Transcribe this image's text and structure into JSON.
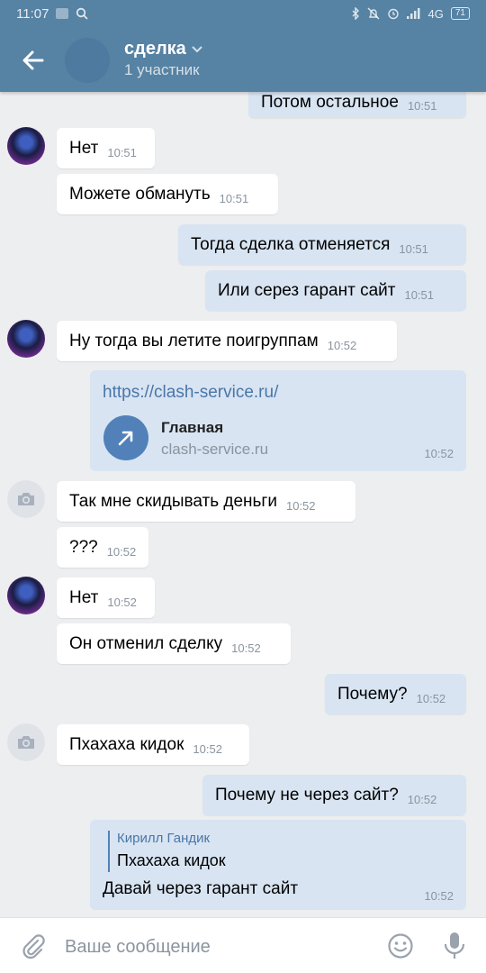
{
  "status": {
    "time": "11:07",
    "battery": "71",
    "network": "4G"
  },
  "header": {
    "title": "сделка",
    "subtitle": "1 участник"
  },
  "messages": [
    {
      "text": "Потом остальное",
      "time": "10:51"
    },
    {
      "text": "Нет",
      "time": "10:51"
    },
    {
      "text": "Можете обмануть",
      "time": "10:51"
    },
    {
      "text": "Тогда сделка отменяется",
      "time": "10:51"
    },
    {
      "text": "Или серез гарант сайт",
      "time": "10:51"
    },
    {
      "text": "Ну тогда вы летите поигруппам",
      "time": "10:52"
    },
    {
      "text": "Так мне скидывать деньги",
      "time": "10:52"
    },
    {
      "text": "???",
      "time": "10:52"
    },
    {
      "text": "Нет",
      "time": "10:52"
    },
    {
      "text": "Он отменил сделку",
      "time": "10:52"
    },
    {
      "text": "Почему?",
      "time": "10:52"
    },
    {
      "text": "Пхахаха кидок",
      "time": "10:52"
    },
    {
      "text": "Почему не через сайт?",
      "time": "10:52"
    }
  ],
  "link": {
    "url": "https://clash-service.ru/",
    "title": "Главная",
    "domain": "clash-service.ru",
    "time": "10:52"
  },
  "reply": {
    "author": "Кирилл Гандик",
    "quoted": "Пхахаха кидок",
    "text": "Давай через гарант сайт",
    "time": "10:52"
  },
  "composer": {
    "placeholder": "Ваше сообщение"
  },
  "colors": {
    "header": "#5682a3",
    "bubble_out": "#d8e4f2",
    "bubble_in": "#ffffff",
    "accent": "#5181b8"
  }
}
